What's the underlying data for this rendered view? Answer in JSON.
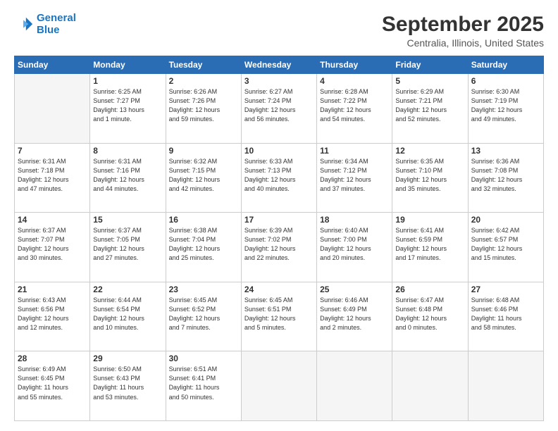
{
  "header": {
    "logo_line1": "General",
    "logo_line2": "Blue",
    "month": "September 2025",
    "location": "Centralia, Illinois, United States"
  },
  "weekdays": [
    "Sunday",
    "Monday",
    "Tuesday",
    "Wednesday",
    "Thursday",
    "Friday",
    "Saturday"
  ],
  "weeks": [
    [
      {
        "day": "",
        "info": ""
      },
      {
        "day": "1",
        "info": "Sunrise: 6:25 AM\nSunset: 7:27 PM\nDaylight: 13 hours\nand 1 minute."
      },
      {
        "day": "2",
        "info": "Sunrise: 6:26 AM\nSunset: 7:26 PM\nDaylight: 12 hours\nand 59 minutes."
      },
      {
        "day": "3",
        "info": "Sunrise: 6:27 AM\nSunset: 7:24 PM\nDaylight: 12 hours\nand 56 minutes."
      },
      {
        "day": "4",
        "info": "Sunrise: 6:28 AM\nSunset: 7:22 PM\nDaylight: 12 hours\nand 54 minutes."
      },
      {
        "day": "5",
        "info": "Sunrise: 6:29 AM\nSunset: 7:21 PM\nDaylight: 12 hours\nand 52 minutes."
      },
      {
        "day": "6",
        "info": "Sunrise: 6:30 AM\nSunset: 7:19 PM\nDaylight: 12 hours\nand 49 minutes."
      }
    ],
    [
      {
        "day": "7",
        "info": "Sunrise: 6:31 AM\nSunset: 7:18 PM\nDaylight: 12 hours\nand 47 minutes."
      },
      {
        "day": "8",
        "info": "Sunrise: 6:31 AM\nSunset: 7:16 PM\nDaylight: 12 hours\nand 44 minutes."
      },
      {
        "day": "9",
        "info": "Sunrise: 6:32 AM\nSunset: 7:15 PM\nDaylight: 12 hours\nand 42 minutes."
      },
      {
        "day": "10",
        "info": "Sunrise: 6:33 AM\nSunset: 7:13 PM\nDaylight: 12 hours\nand 40 minutes."
      },
      {
        "day": "11",
        "info": "Sunrise: 6:34 AM\nSunset: 7:12 PM\nDaylight: 12 hours\nand 37 minutes."
      },
      {
        "day": "12",
        "info": "Sunrise: 6:35 AM\nSunset: 7:10 PM\nDaylight: 12 hours\nand 35 minutes."
      },
      {
        "day": "13",
        "info": "Sunrise: 6:36 AM\nSunset: 7:08 PM\nDaylight: 12 hours\nand 32 minutes."
      }
    ],
    [
      {
        "day": "14",
        "info": "Sunrise: 6:37 AM\nSunset: 7:07 PM\nDaylight: 12 hours\nand 30 minutes."
      },
      {
        "day": "15",
        "info": "Sunrise: 6:37 AM\nSunset: 7:05 PM\nDaylight: 12 hours\nand 27 minutes."
      },
      {
        "day": "16",
        "info": "Sunrise: 6:38 AM\nSunset: 7:04 PM\nDaylight: 12 hours\nand 25 minutes."
      },
      {
        "day": "17",
        "info": "Sunrise: 6:39 AM\nSunset: 7:02 PM\nDaylight: 12 hours\nand 22 minutes."
      },
      {
        "day": "18",
        "info": "Sunrise: 6:40 AM\nSunset: 7:00 PM\nDaylight: 12 hours\nand 20 minutes."
      },
      {
        "day": "19",
        "info": "Sunrise: 6:41 AM\nSunset: 6:59 PM\nDaylight: 12 hours\nand 17 minutes."
      },
      {
        "day": "20",
        "info": "Sunrise: 6:42 AM\nSunset: 6:57 PM\nDaylight: 12 hours\nand 15 minutes."
      }
    ],
    [
      {
        "day": "21",
        "info": "Sunrise: 6:43 AM\nSunset: 6:56 PM\nDaylight: 12 hours\nand 12 minutes."
      },
      {
        "day": "22",
        "info": "Sunrise: 6:44 AM\nSunset: 6:54 PM\nDaylight: 12 hours\nand 10 minutes."
      },
      {
        "day": "23",
        "info": "Sunrise: 6:45 AM\nSunset: 6:52 PM\nDaylight: 12 hours\nand 7 minutes."
      },
      {
        "day": "24",
        "info": "Sunrise: 6:45 AM\nSunset: 6:51 PM\nDaylight: 12 hours\nand 5 minutes."
      },
      {
        "day": "25",
        "info": "Sunrise: 6:46 AM\nSunset: 6:49 PM\nDaylight: 12 hours\nand 2 minutes."
      },
      {
        "day": "26",
        "info": "Sunrise: 6:47 AM\nSunset: 6:48 PM\nDaylight: 12 hours\nand 0 minutes."
      },
      {
        "day": "27",
        "info": "Sunrise: 6:48 AM\nSunset: 6:46 PM\nDaylight: 11 hours\nand 58 minutes."
      }
    ],
    [
      {
        "day": "28",
        "info": "Sunrise: 6:49 AM\nSunset: 6:45 PM\nDaylight: 11 hours\nand 55 minutes."
      },
      {
        "day": "29",
        "info": "Sunrise: 6:50 AM\nSunset: 6:43 PM\nDaylight: 11 hours\nand 53 minutes."
      },
      {
        "day": "30",
        "info": "Sunrise: 6:51 AM\nSunset: 6:41 PM\nDaylight: 11 hours\nand 50 minutes."
      },
      {
        "day": "",
        "info": ""
      },
      {
        "day": "",
        "info": ""
      },
      {
        "day": "",
        "info": ""
      },
      {
        "day": "",
        "info": ""
      }
    ]
  ]
}
